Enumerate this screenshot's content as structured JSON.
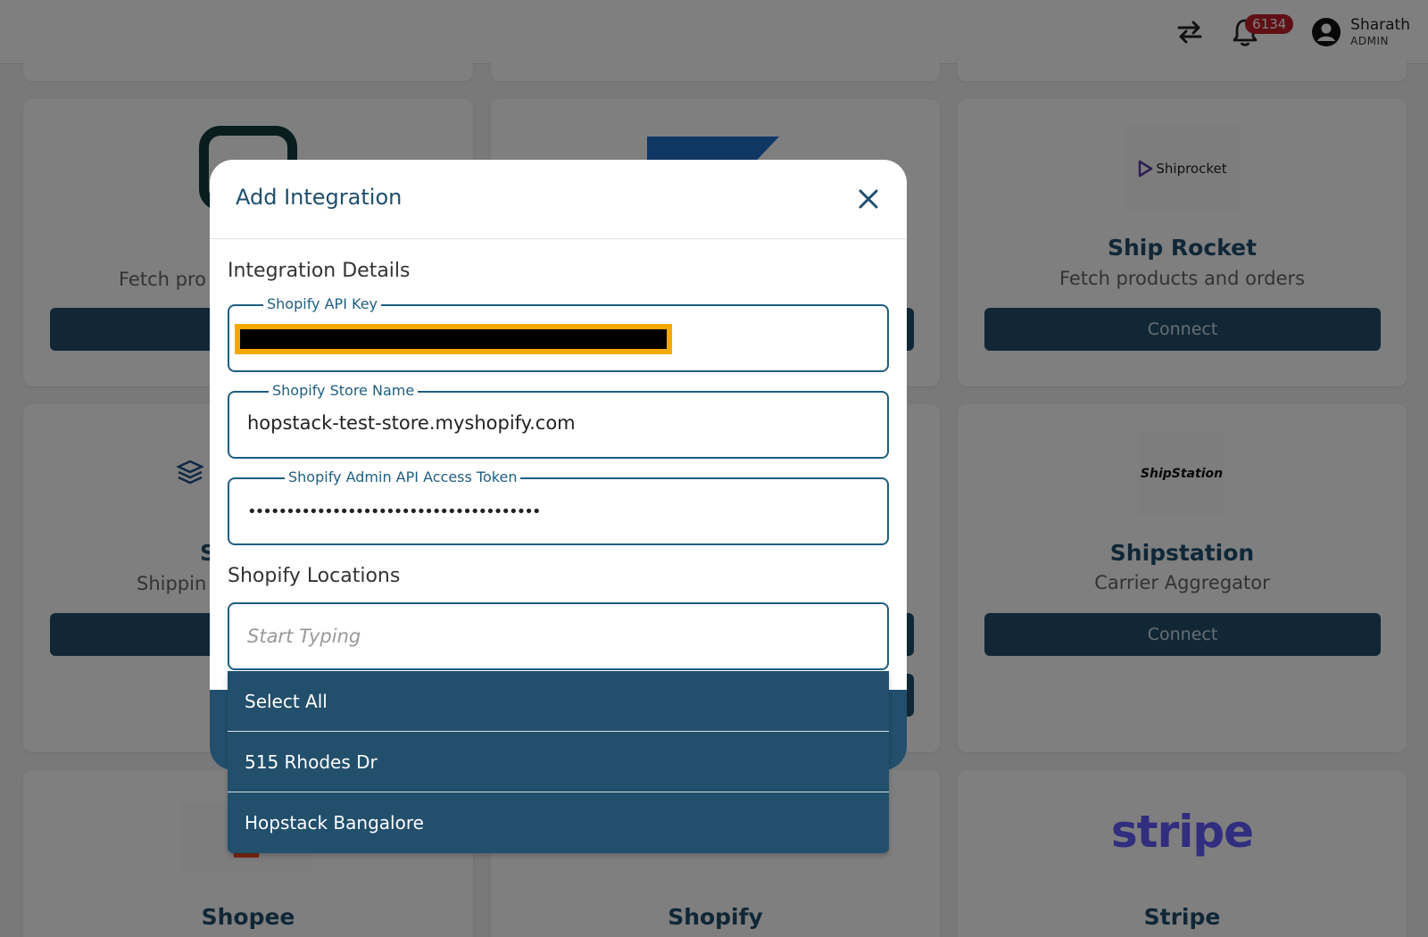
{
  "header": {
    "notification_count": "6134",
    "user_name": "Sharath",
    "user_role": "ADMIN"
  },
  "cards": {
    "card1_sub": "Fetch pro",
    "card4_title": "S",
    "card4_sub": "Shippin",
    "shiprocket": {
      "logo_text": "Shiprocket",
      "title": "Ship Rocket",
      "sub": "Fetch products and orders",
      "button": "Connect"
    },
    "shipstation": {
      "logo_text": "ShipStation",
      "title": "Shipstation",
      "sub": "Carrier Aggregator",
      "button": "Connect"
    },
    "shopee": {
      "title": "Shopee"
    },
    "shopify": {
      "title": "Shopify"
    },
    "stripe": {
      "logo_text": "stripe",
      "title": "Stripe"
    }
  },
  "modal": {
    "title": "Add Integration",
    "section_details": "Integration Details",
    "api_key_label": "Shopify API Key",
    "store_name_label": "Shopify Store Name",
    "store_name_value": "hopstack-test-store.myshopify.com",
    "token_label": "Shopify Admin API Access Token",
    "token_value": "••••••••••••••••••••••••••••••••••••••",
    "section_locations": "Shopify Locations",
    "locations_placeholder": "Start Typing"
  },
  "dropdown": {
    "options": [
      "Select All",
      "515 Rhodes Dr",
      "Hopstack Bangalore"
    ]
  },
  "colors": {
    "primary": "#224f6c",
    "accent_text": "#1f4e6e",
    "badge": "#c0212b",
    "stripe": "#635bff"
  }
}
